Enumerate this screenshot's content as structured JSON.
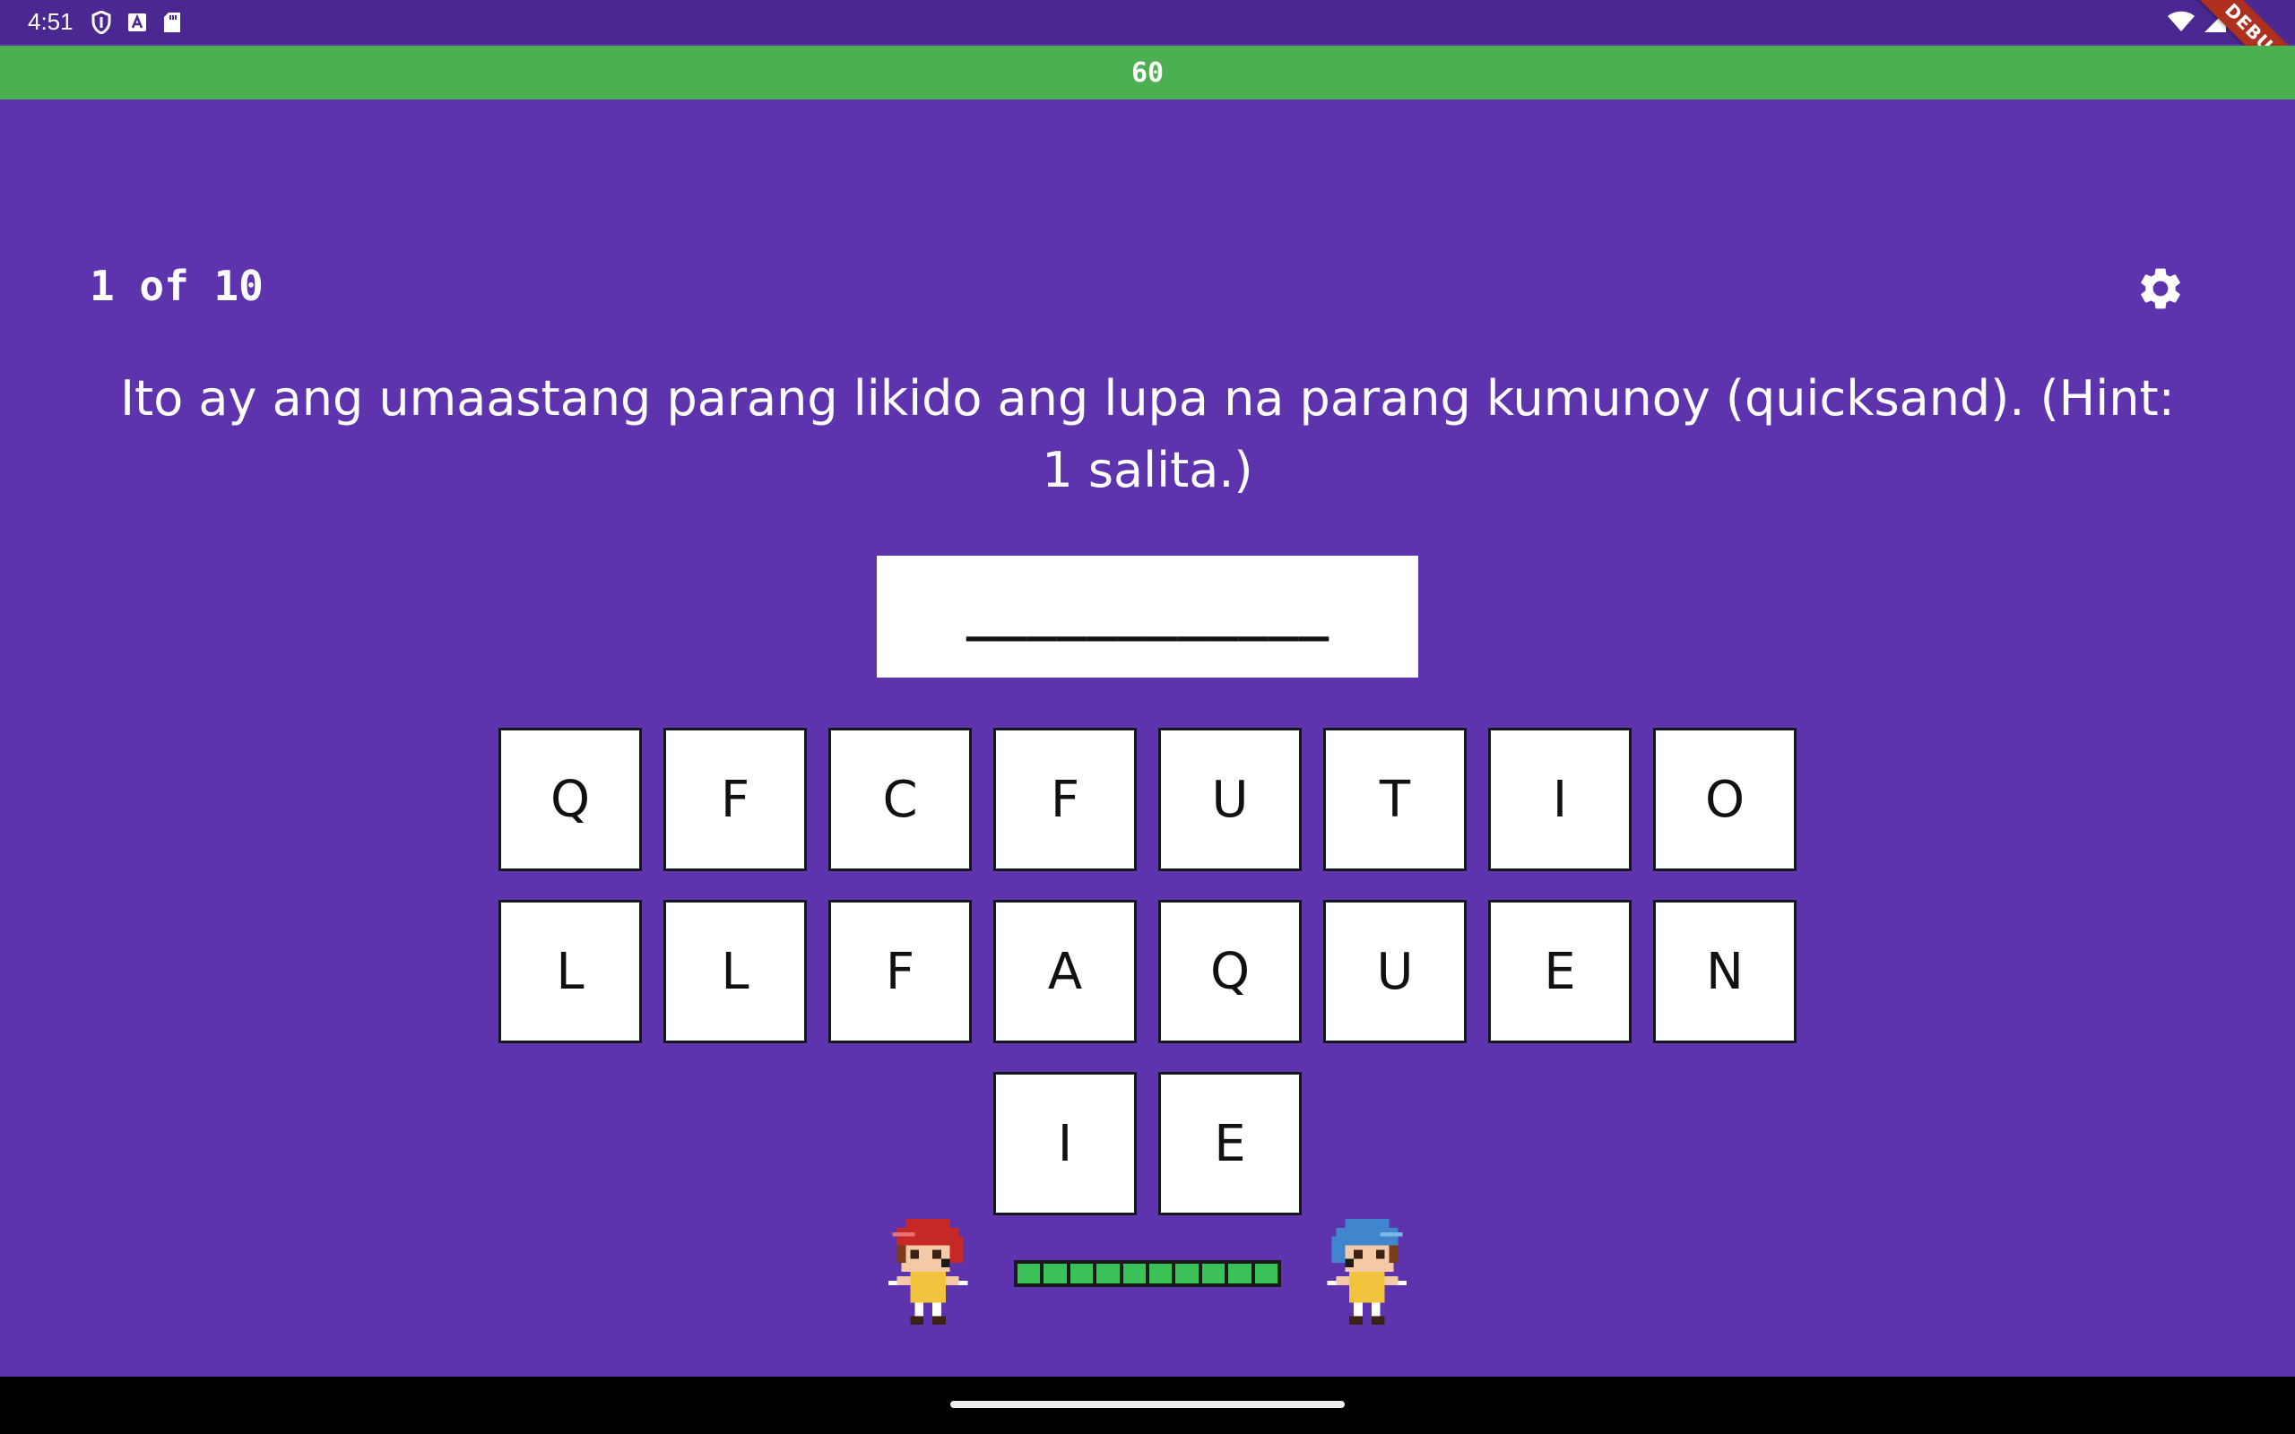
{
  "status_bar": {
    "time": "4:51",
    "left_icons": [
      "shield-icon",
      "a-badge-icon",
      "sd-card-icon"
    ],
    "right_icons": [
      "wifi-icon",
      "signal-icon",
      "battery-icon"
    ]
  },
  "debug_banner": "DEBUG",
  "timer": {
    "value": "60",
    "fraction_remaining": 1.0,
    "color": "#4caf50"
  },
  "progress": {
    "label": "1 of 10"
  },
  "settings": {
    "icon": "gear-icon"
  },
  "question": {
    "text": "Ito ay ang umaastang parang likido ang lupa na parang kumunoy (quicksand). (Hint: 1 salita.)"
  },
  "answer": {
    "display": "____________"
  },
  "keyboard": {
    "row1": [
      "Q",
      "F",
      "C",
      "F",
      "U",
      "T",
      "I",
      "O"
    ],
    "row2": [
      "L",
      "L",
      "F",
      "A",
      "Q",
      "U",
      "E",
      "N"
    ],
    "row3": [
      "I",
      "E"
    ]
  },
  "players": {
    "left": {
      "hair_color": "#c62828"
    },
    "right": {
      "hair_color": "#3f86cf"
    }
  },
  "health": {
    "filled_segments": 10,
    "total_segments": 10,
    "color": "#3ac259"
  },
  "colors": {
    "background": "#5e34ae",
    "status_bar": "#4a2791"
  }
}
